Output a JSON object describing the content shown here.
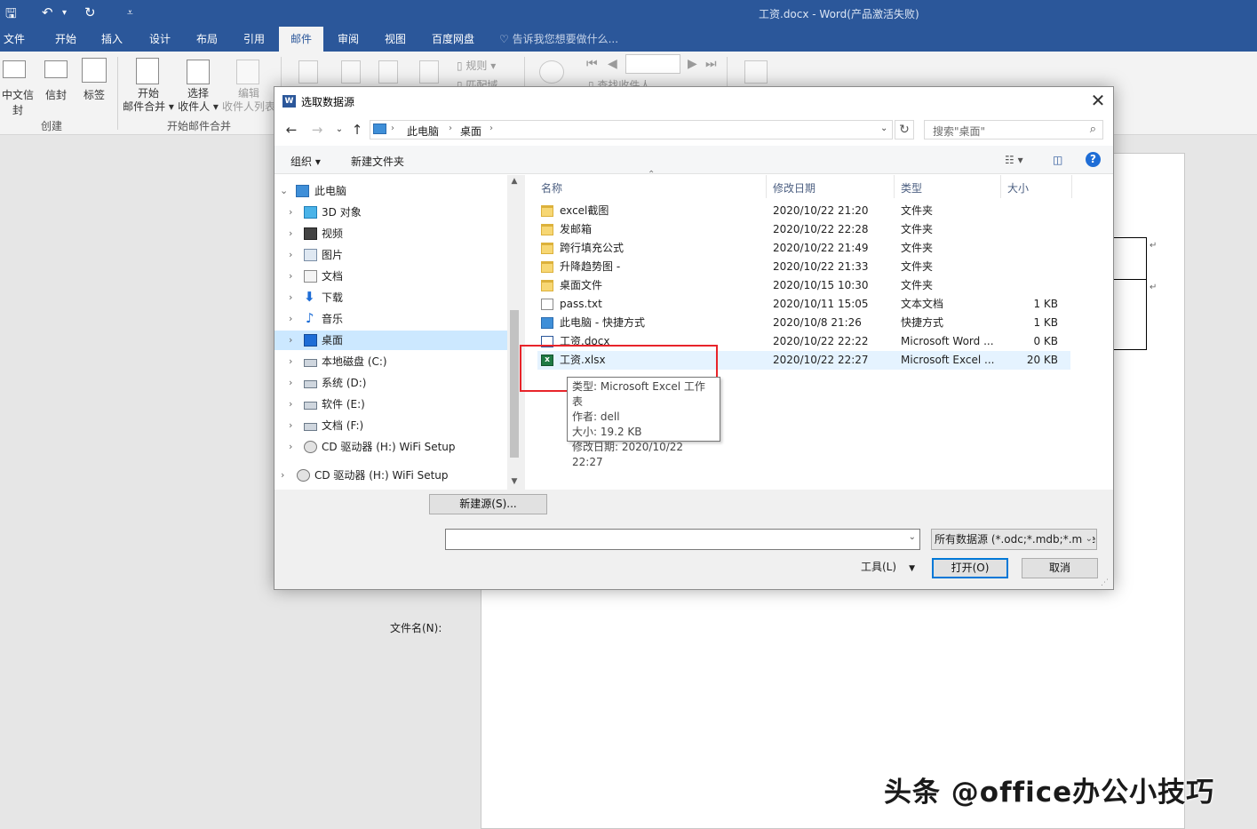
{
  "window": {
    "title": "工资.docx - Word(产品激活失败)",
    "qa": {
      "save": "🖫",
      "undo": "↶",
      "undo_dd": "▾",
      "redo": "↻",
      "customize": "⩡"
    }
  },
  "ribbon": {
    "tabs": [
      "文件",
      "开始",
      "插入",
      "设计",
      "布局",
      "引用",
      "邮件",
      "审阅",
      "视图",
      "百度网盘"
    ],
    "active_tab": "邮件",
    "tell_me": "告诉我您想要做什么...",
    "buttons": {
      "zh_envelope": "中文信封",
      "envelope": "信封",
      "labels": "标签",
      "start_merge_1": "开始",
      "start_merge_2": "邮件合并 ▾",
      "select_recip_1": "选择",
      "select_recip_2": "收件人 ▾",
      "edit_recip_1": "编辑",
      "edit_recip_2": "收件人列表",
      "rules": "规则 ▾",
      "match_fields": "匹配域",
      "find_recipient": "查找收件人"
    },
    "groups": {
      "create": "创建",
      "start_mail_merge": "开始邮件合并"
    }
  },
  "dialog": {
    "title": "选取数据源",
    "close": "✕",
    "breadcrumb": [
      "此电脑",
      "桌面"
    ],
    "search_placeholder": "搜索\"桌面\"",
    "toolbar": {
      "organize": "组织 ▾",
      "new_folder": "新建文件夹"
    },
    "nav_items": [
      {
        "label": "此电脑",
        "icon": "pc-icon"
      },
      {
        "label": "3D 对象",
        "icon": "3d-objects-icon"
      },
      {
        "label": "视频",
        "icon": "video-icon"
      },
      {
        "label": "图片",
        "icon": "pictures-icon"
      },
      {
        "label": "文档",
        "icon": "documents-icon"
      },
      {
        "label": "下载",
        "icon": "download-icon"
      },
      {
        "label": "音乐",
        "icon": "music-icon"
      },
      {
        "label": "桌面",
        "icon": "desktop-icon"
      },
      {
        "label": "本地磁盘 (C:)",
        "icon": "drive-icon"
      },
      {
        "label": "系统 (D:)",
        "icon": "drive-icon"
      },
      {
        "label": "软件 (E:)",
        "icon": "drive-icon"
      },
      {
        "label": "文档 (F:)",
        "icon": "drive-icon"
      },
      {
        "label": "CD 驱动器 (H:) WiFi Setup",
        "icon": "cd-drive-icon"
      },
      {
        "label": "CD 驱动器 (H:) WiFi Setup",
        "icon": "cd-drive-icon"
      }
    ],
    "selected_nav": "桌面",
    "columns": {
      "name": "名称",
      "modified": "修改日期",
      "type": "类型",
      "size": "大小"
    },
    "files": [
      {
        "name": "excel截图",
        "date": "2020/10/22 21:20",
        "type": "文件夹",
        "size": "",
        "icon": "folder-icon"
      },
      {
        "name": "发邮箱",
        "date": "2020/10/22 22:28",
        "type": "文件夹",
        "size": "",
        "icon": "folder-icon"
      },
      {
        "name": "跨行填充公式",
        "date": "2020/10/22 21:49",
        "type": "文件夹",
        "size": "",
        "icon": "folder-icon"
      },
      {
        "name": "升降趋势图 -",
        "date": "2020/10/22 21:33",
        "type": "文件夹",
        "size": "",
        "icon": "folder-icon"
      },
      {
        "name": "桌面文件",
        "date": "2020/10/15 10:30",
        "type": "文件夹",
        "size": "",
        "icon": "folder-icon"
      },
      {
        "name": "pass.txt",
        "date": "2020/10/11 15:05",
        "type": "文本文档",
        "size": "1 KB",
        "icon": "text-file-icon"
      },
      {
        "name": "此电脑 - 快捷方式",
        "date": "2020/10/8 21:26",
        "type": "快捷方式",
        "size": "1 KB",
        "icon": "shortcut-icon"
      },
      {
        "name": "工资.docx",
        "date": "2020/10/22 22:22",
        "type": "Microsoft Word ...",
        "size": "0 KB",
        "icon": "word-file-icon"
      },
      {
        "name": "工资.xlsx",
        "date": "2020/10/22 22:27",
        "type": "Microsoft Excel ...",
        "size": "20 KB",
        "icon": "excel-file-icon"
      }
    ],
    "tooltip": {
      "type": "类型: Microsoft Excel 工作表",
      "author": "作者: dell",
      "size": "大小: 19.2 KB",
      "modified": "修改日期: 2020/10/22 22:27"
    },
    "new_source_button": "新建源(S)...",
    "filename_label": "文件名(N):",
    "filename_value": "",
    "filter": "所有数据源 (*.odc;*.mdb;*.mde",
    "tools": "工具(L)",
    "open": "打开(O)",
    "cancel": "取消"
  },
  "watermark": "头条 @office办公小技巧",
  "colors": {
    "word_blue": "#2b579a",
    "selection": "#cce8ff",
    "highlight_box": "#e8242a"
  }
}
